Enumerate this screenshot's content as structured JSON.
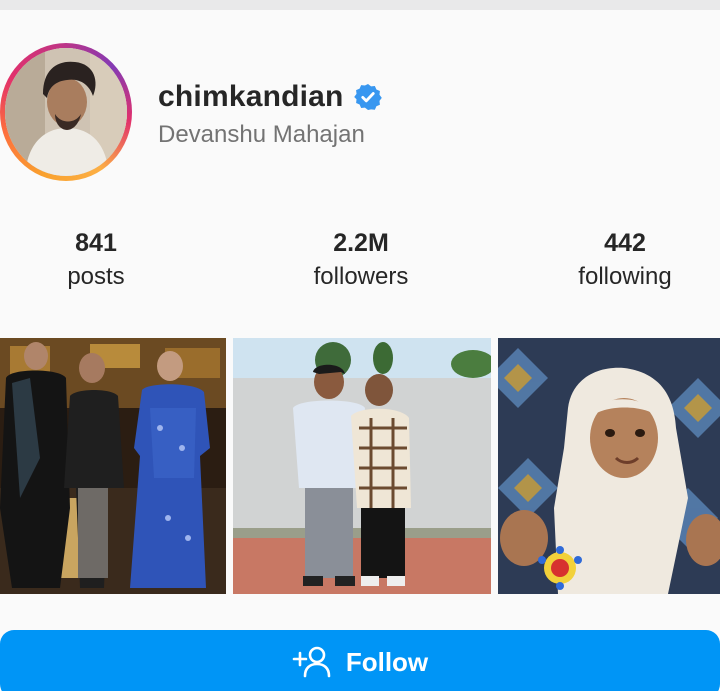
{
  "profile": {
    "username": "chimkandian",
    "full_name": "Devanshu Mahajan",
    "verified": true,
    "verified_color": "#3897f0"
  },
  "stats": [
    {
      "value": "841",
      "label": "posts"
    },
    {
      "value": "2.2M",
      "label": "followers"
    },
    {
      "value": "442",
      "label": "following"
    }
  ],
  "posts": [
    {
      "name": "post-1"
    },
    {
      "name": "post-2"
    },
    {
      "name": "post-3"
    }
  ],
  "follow_button": {
    "label": "Follow",
    "icon": "add-user-icon",
    "color": "#0095f6"
  }
}
